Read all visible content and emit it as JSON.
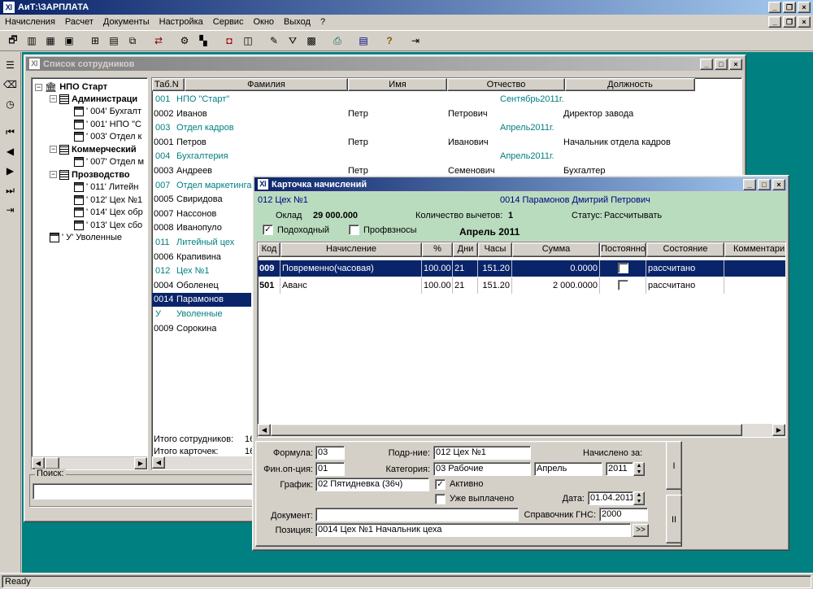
{
  "app": {
    "title": "АиТ:\\ЗАРПЛАТА"
  },
  "menu": [
    "Начисления",
    "Расчет",
    "Документы",
    "Настройка",
    "Сервис",
    "Окно",
    "Выход",
    "?"
  ],
  "mdi_controls": [
    "_",
    "▫",
    "×"
  ],
  "employees_window": {
    "title": "Список сотрудников",
    "tree": [
      {
        "label": "НПО Старт",
        "level": 0,
        "bold": true
      },
      {
        "label": "Администраци",
        "level": 1,
        "bold": true
      },
      {
        "label": "' 004' Бухгалт",
        "level": 2
      },
      {
        "label": "' 001' НПО \"С",
        "level": 2
      },
      {
        "label": "' 003' Отдел к",
        "level": 2
      },
      {
        "label": "Коммерческий",
        "level": 1,
        "bold": true
      },
      {
        "label": "' 007' Отдел м",
        "level": 2
      },
      {
        "label": "Прозводство",
        "level": 1,
        "bold": true
      },
      {
        "label": "' 011' Литейн",
        "level": 2
      },
      {
        "label": "' 012' Цех №1",
        "level": 2
      },
      {
        "label": "' 014' Цех обр",
        "level": 2
      },
      {
        "label": "' 013' Цех сбо",
        "level": 2
      },
      {
        "label": "' У' Уволенные",
        "level": 1
      }
    ],
    "columns": [
      "Таб.N",
      "Фамилия",
      "Имя",
      "Отчество",
      "Должность"
    ],
    "rows": [
      {
        "type": "group",
        "tab": "001",
        "name": "НПО \"Старт\"",
        "date": "Сентябрь2011г."
      },
      {
        "type": "emp",
        "tab": "0002",
        "name": "Иванов",
        "first": "Петр",
        "middle": "Петрович",
        "post": "Директор завода"
      },
      {
        "type": "group",
        "tab": "003",
        "name": "Отдел кадров",
        "date": "Апрель2011г."
      },
      {
        "type": "emp",
        "tab": "0001",
        "name": "Петров",
        "first": "Петр",
        "middle": "Иванович",
        "post": "Начальник отдела кадров"
      },
      {
        "type": "group",
        "tab": "004",
        "name": "Бухгалтерия",
        "date": "Апрель2011г."
      },
      {
        "type": "emp",
        "tab": "0003",
        "name": "Андреев",
        "first": "Петр",
        "middle": "Семенович",
        "post": "Бухгалтер"
      },
      {
        "type": "group",
        "tab": "007",
        "name": "Отдел маркетинга",
        "date": ""
      },
      {
        "type": "emp",
        "tab": "0005",
        "name": "Свиридова",
        "first": "",
        "middle": "",
        "post": ""
      },
      {
        "type": "emp",
        "tab": "0007",
        "name": "Нассонов",
        "first": "",
        "middle": "",
        "post": ""
      },
      {
        "type": "emp",
        "tab": "0008",
        "name": "Иванопуло",
        "first": "",
        "middle": "",
        "post": ""
      },
      {
        "type": "group",
        "tab": "011",
        "name": "Литейный цех",
        "date": ""
      },
      {
        "type": "emp",
        "tab": "0006",
        "name": "Крапивина",
        "first": "",
        "middle": "",
        "post": ""
      },
      {
        "type": "group",
        "tab": "012",
        "name": "Цех №1",
        "date": ""
      },
      {
        "type": "emp",
        "tab": "0004",
        "name": "Оболенец",
        "first": "",
        "middle": "",
        "post": ""
      },
      {
        "type": "emp",
        "tab": "0014",
        "name": "Парамонов",
        "first": "",
        "middle": "",
        "post": "",
        "selected": true
      },
      {
        "type": "group",
        "tab": "У",
        "name": "Уволенные",
        "date": ""
      },
      {
        "type": "emp",
        "tab": "0009",
        "name": "Сорокина",
        "first": "",
        "middle": "",
        "post": ""
      }
    ],
    "totals": [
      {
        "label": "Итого сотрудников:",
        "value": "16"
      },
      {
        "label": "Итого карточек:",
        "value": "16"
      }
    ],
    "search_label": "Поиск:",
    "search_value": ""
  },
  "card_window": {
    "title": "Карточка начислений",
    "dept": "012 Цех №1",
    "employee": "0014 Парамонов Дмитрий Петрович",
    "salary_label": "Оклад",
    "salary_value": "29 000.000",
    "deductions_label": "Количество вычетов:",
    "deductions_value": "1",
    "status_label": "Статус:",
    "status_value": "Рассчитывать",
    "income_tax_label": "Подоходный",
    "income_tax_checked": true,
    "union_label": "Профвзносы",
    "union_checked": false,
    "period": "Апрель 2011",
    "columns": [
      "Код",
      "Начисление",
      "%",
      "Дни",
      "Часы",
      "Сумма",
      "Постоянно",
      "Состояние",
      "Комментари"
    ],
    "rows": [
      {
        "code": "009",
        "name": "Повременно(часовая)",
        "pct": "100.00",
        "days": "21",
        "hours": "151.20",
        "sum": "0.0000",
        "permanent": false,
        "state": "рассчитано",
        "comment": "",
        "selected": true
      },
      {
        "code": "501",
        "name": "Аванс",
        "pct": "100.00",
        "days": "21",
        "hours": "151.20",
        "sum": "2 000.0000",
        "permanent": false,
        "state": "рассчитано",
        "comment": ""
      }
    ],
    "form": {
      "formula_label": "Формула:",
      "formula": "03",
      "finop_label": "Фин.оп-ция:",
      "finop": "01",
      "schedule_label": "График:",
      "schedule": "02 Пятидневка (36ч)",
      "document_label": "Документ:",
      "document": "",
      "position_label": "Позиция:",
      "position": "0014 Цех №1 Начальник цеха",
      "subdiv_label": "Подр-ние:",
      "subdiv": "012 Цех №1",
      "category_label": "Категория:",
      "category": "03 Рабочие",
      "active_label": "Активно",
      "active": true,
      "paid_label": "Уже выплачено",
      "paid": false,
      "accrued_label": "Начислено за:",
      "accrued_month": "Апрель",
      "accrued_year": "2011",
      "date_label": "Дата:",
      "date": "01.04.2011",
      "gns_label": "Справочник ГНС:",
      "gns": "2000",
      "more_button": ">>",
      "tab1": "I",
      "tab2": "II"
    }
  },
  "status_bar": "Ready"
}
